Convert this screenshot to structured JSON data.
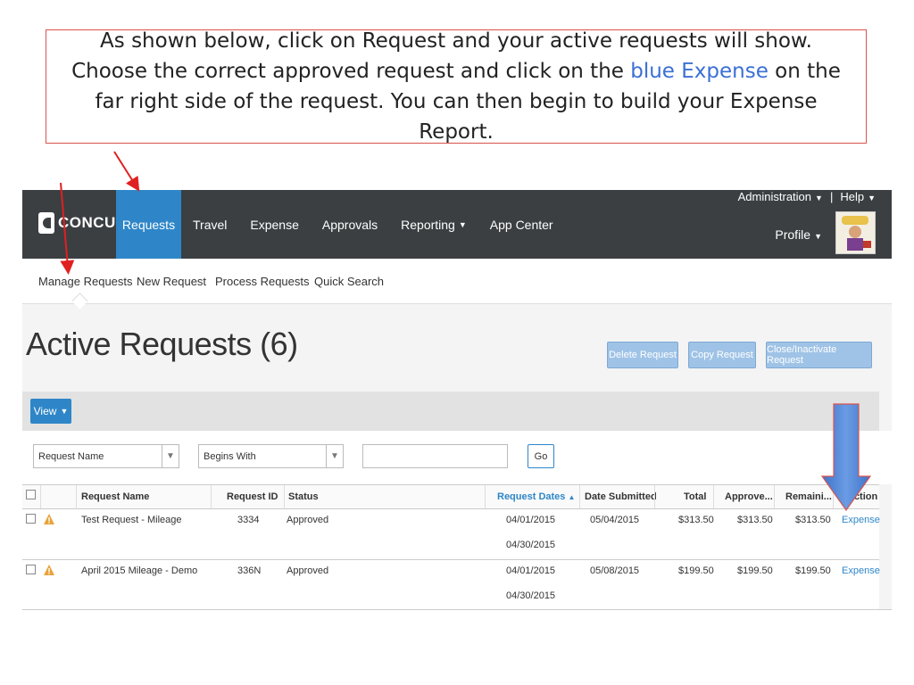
{
  "instruction": {
    "before": "As shown below, click on Request and your active requests will show.  Choose the correct approved request and click on the ",
    "highlight": "blue Expense",
    "after": " on the far right side of the request.  You can then begin to build your Expense Report."
  },
  "app": {
    "logo_text": "CONCUR",
    "nav": [
      "Requests",
      "Travel",
      "Expense",
      "Approvals",
      "Reporting",
      "App Center"
    ],
    "admin": "Administration",
    "separator": "|",
    "help": "Help",
    "profile": "Profile",
    "subnav": [
      "Manage Requests",
      "New Request",
      "Process Requests",
      "Quick Search"
    ],
    "page_title": "Active Requests (6)",
    "buttons": {
      "delete": "Delete Request",
      "copy": "Copy Request",
      "close": "Close/Inactivate Request",
      "view": "View",
      "go": "Go"
    },
    "filters": {
      "field": "Request Name",
      "operator": "Begins With",
      "value": ""
    },
    "table": {
      "headers": [
        "Request Name",
        "Request ID",
        "Status",
        "Request Dates",
        "Date Submitted",
        "Total",
        "Approve...",
        "Remaini...",
        "Action"
      ],
      "sort_indicator": "▲",
      "rows": [
        {
          "name": "Test Request - Mileage",
          "id": "3334",
          "status": "Approved",
          "date_start": "04/01/2015",
          "date_end": "04/30/2015",
          "submitted": "05/04/2015",
          "total": "$313.50",
          "approved": "$313.50",
          "remaining": "$313.50",
          "action": "Expense"
        },
        {
          "name": "April 2015 Mileage - Demo",
          "id": "336N",
          "status": "Approved",
          "date_start": "04/01/2015",
          "date_end": "04/30/2015",
          "submitted": "05/08/2015",
          "total": "$199.50",
          "approved": "$199.50",
          "remaining": "$199.50",
          "action": "Expense"
        }
      ]
    }
  },
  "colors": {
    "callout_border": "#d9534f",
    "highlight": "#3b6fd6",
    "topbar": "#3b3f42",
    "active_tab": "#2e86c8",
    "arrow_red": "#e02020",
    "arrow_blue": "#4a86d8"
  }
}
